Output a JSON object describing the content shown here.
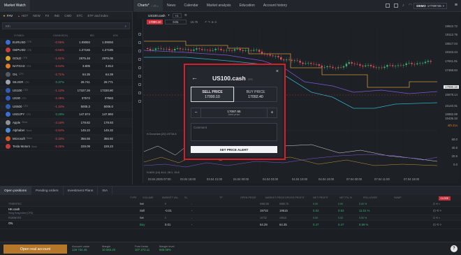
{
  "top_tabs": {
    "market_watch": "Market Watch",
    "charts": "Charts*",
    "news": "News",
    "calendar": "Calendar",
    "market_analysis": "Market analysis",
    "education": "Education",
    "account_history": "Account history"
  },
  "account": {
    "label": "DEMO",
    "number": "17799746"
  },
  "market_watch": {
    "tabs": [
      "FAV",
      "HOT",
      "NEW",
      "FX",
      "IND",
      "CMD",
      "STC",
      "ETF and index"
    ],
    "search_value": "Eth",
    "columns": [
      "SYMBOL",
      "CHANGE(%)",
      "BID",
      "ASK"
    ],
    "rows": [
      {
        "symbol": "EURUSD",
        "tag": "CFD",
        "change": "-0.06%",
        "bid": "1.09084",
        "ask": "1.09093",
        "dir": "neg",
        "color": "#3a6fd8"
      },
      {
        "symbol": "GBPUSD",
        "tag": "CFD",
        "change": "-0.66%",
        "bid": "1.27166",
        "ask": "1.27185",
        "dir": "neg",
        "color": "#c43d3d"
      },
      {
        "symbol": "GOLD",
        "tag": "CFD",
        "change": "-1.81%",
        "bid": "2975.46",
        "ask": "2976.06",
        "dir": "neg",
        "color": "#d4a72c"
      },
      {
        "symbol": "NATGAS",
        "tag": "CFD",
        "change": "-3.64%",
        "bid": "3.805",
        "ask": "3.814",
        "dir": "neg",
        "color": "#e07b2a"
      },
      {
        "symbol": "OIL",
        "tag": "CFD",
        "change": "-2.71%",
        "bid": "64.35",
        "ask": "64.39",
        "dir": "neg",
        "color": "#555a62"
      },
      {
        "symbol": "SILVER",
        "tag": "CFD",
        "change": "0.37%",
        "bid": "29.741",
        "ask": "29.771",
        "dir": "pos",
        "color": "#9ea3aa"
      },
      {
        "symbol": "US100",
        "tag": "CFD",
        "change": "-1.13%",
        "bid": "17327.26",
        "ask": "17330.80",
        "dir": "neg",
        "color": "#2f5fb3"
      },
      {
        "symbol": "US30",
        "tag": "CFD",
        "change": "-2.49%",
        "bid": "37572",
        "ask": "37583",
        "dir": "neg",
        "color": "#2f5fb3"
      },
      {
        "symbol": "US500",
        "tag": "CFD",
        "change": "-1.34%",
        "bid": "5005.3",
        "ask": "5006.0",
        "dir": "neg",
        "color": "#2f5fb3"
      },
      {
        "symbol": "USDJPY",
        "tag": "CFD",
        "change": "0.29%",
        "bid": "147.974",
        "ask": "147.993",
        "dir": "pos",
        "color": "#3a6fd8"
      },
      {
        "symbol": "Apple",
        "tag": "Stock",
        "change": "-3.16%",
        "bid": "178.82",
        "ask": "178.93",
        "dir": "neg",
        "color": "#8d9299"
      },
      {
        "symbol": "Alphabet",
        "tag": "Stock",
        "change": "-2.54%",
        "bid": "145.22",
        "ask": "145.32",
        "dir": "neg",
        "color": "#4a8ad6"
      },
      {
        "symbol": "Microsoft",
        "tag": "Stock",
        "change": "-2.33%",
        "bid": "356.55",
        "ask": "356.92",
        "dir": "neg",
        "color": "#d05a2a"
      },
      {
        "symbol": "Tesla Motors",
        "tag": "Stock",
        "change": "-5.26%",
        "bid": "228.09",
        "ask": "228.23",
        "dir": "neg",
        "color": "#c43d3d"
      }
    ]
  },
  "chart": {
    "symbol": "US100.cash",
    "timeframe": "H1",
    "sell_box": "17090.10",
    "volume": "0.01",
    "buy_box": "16.78",
    "price_ticks": [
      "19622.72",
      "19112.76",
      "18517.04",
      "18163.44",
      "17841.81",
      "17468.84",
      "17090.10",
      "16678.14",
      "16140.91",
      "15882.89",
      "15436.10",
      "4th 21s",
      "60.0",
      "40.6",
      "20.6",
      "0.0"
    ],
    "time_ticks": [
      "03.04.2025 07:00",
      "03.04 18:00",
      "03.04 21:00",
      "04.04 00:00",
      "04.04 03:00",
      "04.04 10:00",
      "04.04 19:00",
      "07.04 00:00",
      "07.04 11:00",
      "07.04 18:00"
    ],
    "indicator_top": "N Donchian (20) 19716.8",
    "indicator_bottom": "N ADX (14) 44.6, 28.1, 15.8"
  },
  "alert_modal": {
    "title": "US100.cash",
    "title_tag": "CFD",
    "sell_label": "SELL PRICE",
    "sell_value": "17090.10",
    "buy_label": "BUY PRICE",
    "buy_value": "17092.40",
    "stepper_value": "17087.65",
    "stepper_sub": "Alert price",
    "comment_placeholder": "Comment",
    "set_button": "SET PRICE ALERT"
  },
  "bottom_tabs": [
    "Open positions",
    "Pending orders",
    "Investment Plans",
    "ISA"
  ],
  "positions": {
    "columns": [
      "TYPE",
      "VOLUME",
      "MARKET VAL.",
      "SL",
      "TP",
      "OPEN PRICE",
      "MARKET PRICE",
      "GROSS PROFIT",
      "NET PROFIT",
      "NET P/L %",
      "ROLLOVER",
      "SWAP"
    ],
    "close_all": "CLOSE",
    "rows": [
      {
        "sub": "TSSESTEC",
        "type": "Sell",
        "volume": "0",
        "sl": "-",
        "open": "5980.55",
        "market": "5980.75",
        "gross": "0.00",
        "net": "0.00",
        "pl": "0.00 %"
      },
      {
        "symbol": "HK.cash",
        "sub": "Hong Kong Index (CFD)",
        "type": "Sell",
        "volume": "-0.01",
        "sl": "-",
        "open": "19732",
        "market": "19515",
        "gross": "0.53",
        "net": "0.53",
        "pl": "11.01 %"
      },
      {
        "sub": "ROBINTES",
        "type": "Sell",
        "volume": "0",
        "sl": "-",
        "open": "19732",
        "market": "19515",
        "gross": "0.00",
        "net": "0.53",
        "pl": "0.00 %"
      },
      {
        "symbol": "OIL",
        "sub": "",
        "type": "Buy",
        "volume": "0.01",
        "sl": "-",
        "open": "64.29",
        "market": "64.35",
        "gross": "0.47",
        "net": "0.47",
        "pl": "0.59 %"
      }
    ]
  },
  "footer": {
    "open_account": "Open real account",
    "stats": [
      {
        "label": "Account value",
        "value": "129 734.45"
      },
      {
        "label": "Margin",
        "value": "10 583.20"
      },
      {
        "label": "Free funds",
        "value": "107 273.11"
      },
      {
        "label": "Margin level",
        "value": "685.09%"
      }
    ],
    "help": "?"
  },
  "colors": {
    "sell": "#e0505a",
    "buy": "#37b375",
    "accent": "#b5782a",
    "highlight": "#d21f2a"
  }
}
